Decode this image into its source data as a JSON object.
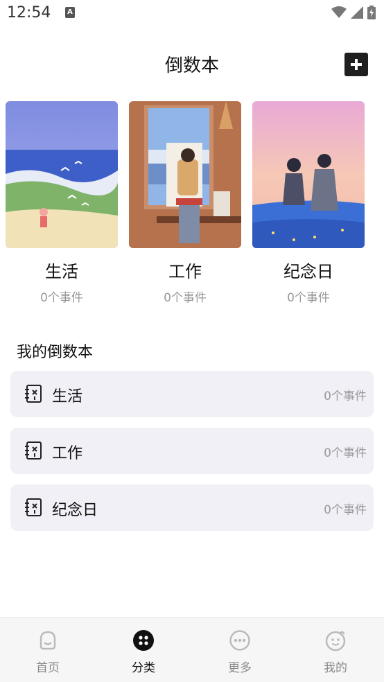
{
  "status_bar": {
    "time": "12:54"
  },
  "header": {
    "title": "倒数本"
  },
  "cards": [
    {
      "title": "生活",
      "count": "0个事件"
    },
    {
      "title": "工作",
      "count": "0个事件"
    },
    {
      "title": "纪念日",
      "count": "0个事件"
    }
  ],
  "section": {
    "title": "我的倒数本"
  },
  "list": [
    {
      "label": "生活",
      "count": "0个事件"
    },
    {
      "label": "工作",
      "count": "0个事件"
    },
    {
      "label": "纪念日",
      "count": "0个事件"
    }
  ],
  "tabs": [
    {
      "label": "首页",
      "icon": "home-face-icon"
    },
    {
      "label": "分类",
      "icon": "category-dots-icon"
    },
    {
      "label": "更多",
      "icon": "more-dots-icon"
    },
    {
      "label": "我的",
      "icon": "profile-face-icon"
    }
  ],
  "active_tab": "分类",
  "colors": {
    "accent": "#1f1f1f",
    "row_bg": "#f1f0f6",
    "muted_text": "#999999",
    "tab_bar_bg": "#f6f6f6"
  }
}
